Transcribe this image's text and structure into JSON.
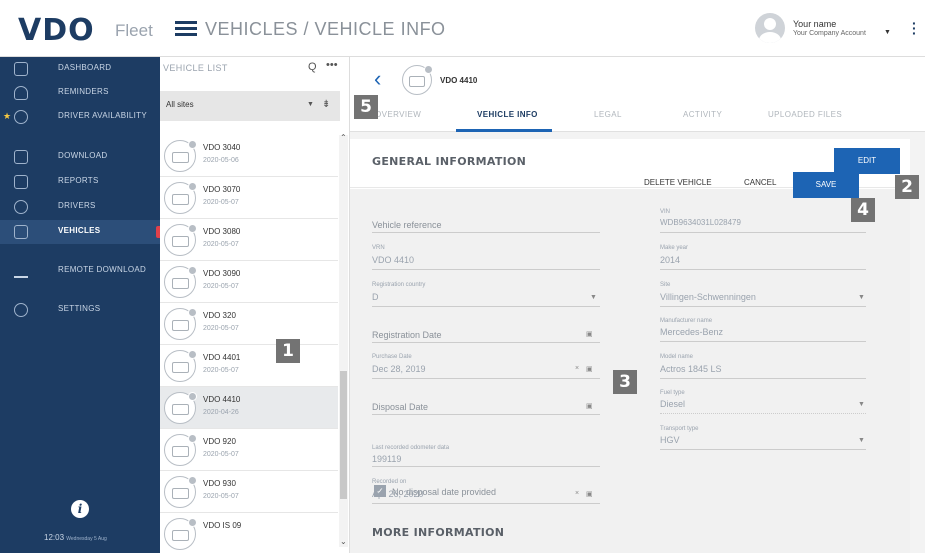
{
  "topbar": {
    "logo": "VDO",
    "product": "Fleet",
    "title": "VEHICLES / VEHICLE INFO",
    "user_name": "Your name",
    "user_company": "Your Company Account",
    "user_caret": "▼",
    "kebab": "⋮"
  },
  "sidebar": {
    "items": [
      {
        "label": "DASHBOARD",
        "icon": "dashboard-icon"
      },
      {
        "label": "REMINDERS",
        "icon": "bell-icon"
      },
      {
        "label": "DRIVER AVAILABILITY",
        "icon": "clock-icon"
      },
      {
        "label": "DOWNLOAD",
        "icon": "download-icon"
      },
      {
        "label": "REPORTS",
        "icon": "report-icon"
      },
      {
        "label": "DRIVERS",
        "icon": "driver-icon"
      },
      {
        "label": "VEHICLES",
        "icon": "truck-icon",
        "active": true
      },
      {
        "label": "REMOTE DOWNLOAD",
        "icon": "remote-download-icon"
      },
      {
        "label": "SETTINGS",
        "icon": "gear-icon"
      }
    ],
    "info": "i",
    "clock_time": "12:03",
    "clock_date": "Wednesday 5 Aug"
  },
  "vehicle_list": {
    "title": "VEHICLE LIST",
    "search_icon": "Q",
    "more_icon": "•••",
    "site_filter": "All sites",
    "site_caret": "▼",
    "sort_icon": "⇟",
    "items": [
      {
        "name": "VDO 3040",
        "date": "2020-05-06"
      },
      {
        "name": "VDO 3070",
        "date": "2020-05-07"
      },
      {
        "name": "VDO 3080",
        "date": "2020-05-07"
      },
      {
        "name": "VDO 3090",
        "date": "2020-05-07"
      },
      {
        "name": "VDO 320",
        "date": "2020-05-07"
      },
      {
        "name": "VDO 4401",
        "date": "2020-05-07"
      },
      {
        "name": "VDO 4410",
        "date": "2020-04-26",
        "selected": true
      },
      {
        "name": "VDO 920",
        "date": "2020-05-07"
      },
      {
        "name": "VDO 930",
        "date": "2020-05-07"
      },
      {
        "name": "VDO IS 09",
        "date": ""
      }
    ]
  },
  "detail": {
    "back": "‹",
    "vehicle_name": "VDO 4410",
    "tabs": [
      "OVERVIEW",
      "VEHICLE INFO",
      "LEGAL",
      "ACTIVITY",
      "UPLOADED FILES"
    ],
    "section_title": "GENERAL INFORMATION",
    "more_section_title": "MORE INFORMATION",
    "buttons": {
      "edit": "EDIT",
      "delete": "DELETE VEHICLE",
      "cancel": "CANCEL",
      "save": "SAVE"
    },
    "left_fields": {
      "vehicle_reference": {
        "placeholder": "Vehicle reference"
      },
      "vin": {
        "label": "VRN",
        "value": "VDO 4410"
      },
      "registration_country": {
        "label": "Registration country",
        "value": "D",
        "caret": "▼"
      },
      "registration_date": {
        "placeholder": "Registration Date",
        "icon": "▣"
      },
      "purchase_date": {
        "label": "Purchase Date",
        "value": "Dec 28, 2019",
        "clear": "×",
        "icon": "▣"
      },
      "disposal_date": {
        "placeholder": "Disposal Date",
        "icon": "▣"
      },
      "no_disposal": {
        "label": "No disposal date provided",
        "check": "✓"
      },
      "last_odometer": {
        "label": "Last recorded odometer data",
        "value": "199119"
      },
      "recorded_on": {
        "label": "Recorded on",
        "value": "Apr 26, 2020",
        "clear": "×",
        "icon": "▣"
      }
    },
    "right_fields": {
      "vin": {
        "label": "VIN",
        "value": "WDB9634031L028479"
      },
      "make_year": {
        "label": "Make year",
        "value": "2014"
      },
      "site": {
        "label": "Site",
        "value": "Villingen-Schwenningen",
        "caret": "▼"
      },
      "manufacturer": {
        "label": "Manufacturer name",
        "value": "Mercedes-Benz"
      },
      "model": {
        "label": "Model name",
        "value": "Actros 1845 LS"
      },
      "fuel": {
        "label": "Fuel type",
        "value": "Diesel",
        "caret": "▼"
      },
      "transport": {
        "label": "Transport type",
        "value": "HGV",
        "caret": "▼"
      }
    }
  },
  "callouts": [
    "1",
    "2",
    "3",
    "4",
    "5"
  ]
}
